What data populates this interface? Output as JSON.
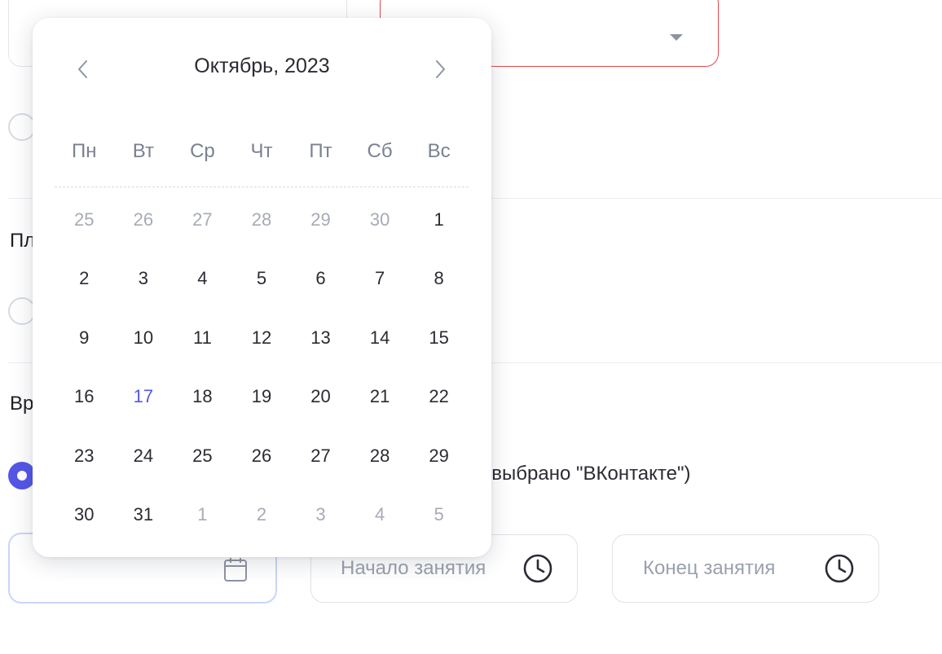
{
  "form": {
    "section_platform_label": "Пл",
    "section_time_label": "Вр",
    "radio_text": "сли платформой выбрано \"ВКонтакте\")",
    "start_time_placeholder": "Начало занятия",
    "end_time_placeholder": "Конец занятия"
  },
  "calendar": {
    "title": "Октябрь, 2023",
    "weekdays": [
      "Пн",
      "Вт",
      "Ср",
      "Чт",
      "Пт",
      "Сб",
      "Вс"
    ],
    "weeks": [
      [
        "25",
        "26",
        "27",
        "28",
        "29",
        "30",
        "1"
      ],
      [
        "2",
        "3",
        "4",
        "5",
        "6",
        "7",
        "8"
      ],
      [
        "9",
        "10",
        "11",
        "12",
        "13",
        "14",
        "15"
      ],
      [
        "16",
        "17",
        "18",
        "19",
        "20",
        "21",
        "22"
      ],
      [
        "23",
        "24",
        "25",
        "26",
        "27",
        "28",
        "29"
      ],
      [
        "30",
        "31",
        "1",
        "2",
        "3",
        "4",
        "5"
      ]
    ],
    "today": "17"
  },
  "colors": {
    "accent": "#5457e6",
    "error_border": "#e5484d",
    "muted_text": "#a6abb6"
  },
  "icons": {
    "prev": "chevron-left-icon",
    "next": "chevron-right-icon",
    "calendar": "calendar-icon",
    "clock": "clock-icon",
    "dropdown": "caret-down-icon"
  }
}
